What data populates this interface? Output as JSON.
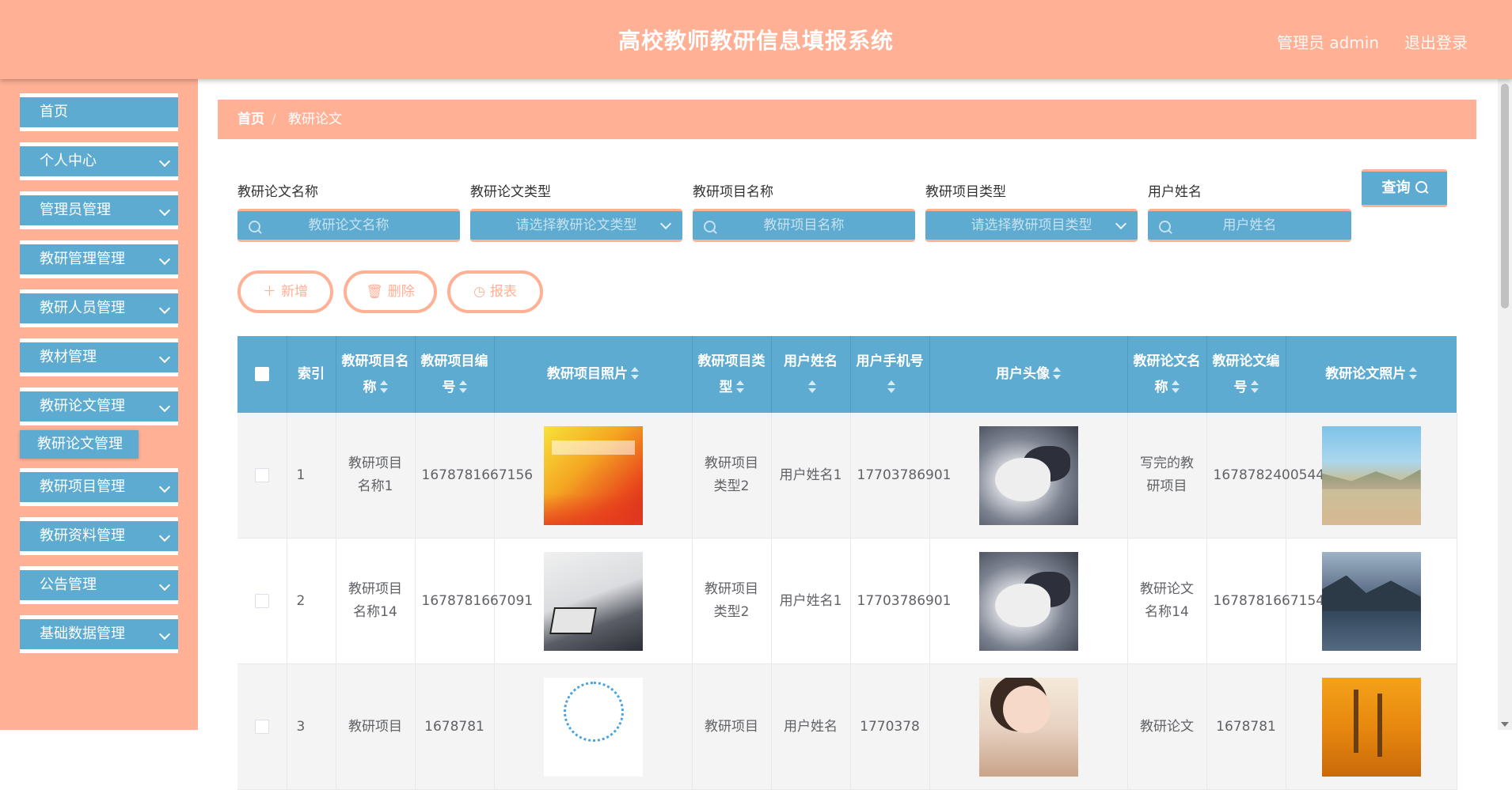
{
  "header": {
    "title": "高校教师教研信息填报系统",
    "user": "管理员 admin",
    "logout": "退出登录"
  },
  "sidebar": {
    "items": [
      {
        "label": "首页"
      },
      {
        "label": "个人中心"
      },
      {
        "label": "管理员管理"
      },
      {
        "label": "教研管理管理"
      },
      {
        "label": "教研人员管理"
      },
      {
        "label": "教材管理"
      },
      {
        "label": "教研论文管理"
      },
      {
        "label": "教研项目管理"
      },
      {
        "label": "教研资料管理"
      },
      {
        "label": "公告管理"
      },
      {
        "label": "基础数据管理"
      }
    ],
    "active_sub": "教研论文管理"
  },
  "breadcrumb": {
    "home": "首页",
    "separator": "/",
    "current": "教研论文"
  },
  "search": {
    "fields": [
      {
        "label": "教研论文名称",
        "placeholder": "教研论文名称"
      },
      {
        "label": "教研论文类型",
        "placeholder": "请选择教研论文类型"
      },
      {
        "label": "教研项目名称",
        "placeholder": "教研项目名称"
      },
      {
        "label": "教研项目类型",
        "placeholder": "请选择教研项目类型"
      },
      {
        "label": "用户姓名",
        "placeholder": "用户姓名"
      }
    ],
    "query_label": "查询"
  },
  "actions": {
    "add": "新增",
    "delete": "删除",
    "report": "报表"
  },
  "table": {
    "headers": [
      "索引",
      "教研项目名称",
      "教研项目编号",
      "教研项目照片",
      "教研项目类型",
      "用户姓名",
      "用户手机号",
      "用户头像",
      "教研论文名称",
      "教研论文编号",
      "教研论文照片"
    ],
    "rows": [
      {
        "index": "1",
        "project_name": "教研项目名称1",
        "project_no": "1678781667156",
        "project_photo": "poster-image",
        "project_type": "教研项目类型2",
        "user_name": "用户姓名1",
        "phone": "17703786901",
        "avatar": "husky-image",
        "paper_name": "写完的教研项目",
        "paper_no": "1678782400544",
        "paper_photo": "desert-image"
      },
      {
        "index": "2",
        "project_name": "教研项目名称14",
        "project_no": "1678781667091",
        "project_photo": "business-image",
        "project_type": "教研项目类型2",
        "user_name": "用户姓名1",
        "phone": "17703786901",
        "avatar": "husky-image",
        "paper_name": "教研论文名称14",
        "paper_no": "1678781667154",
        "paper_photo": "lake-image"
      },
      {
        "index": "3",
        "project_name": "教研项目",
        "project_no": "1678781",
        "project_photo": "network-image",
        "project_type": "教研项目",
        "user_name": "用户姓名",
        "phone": "1770378",
        "avatar": "girl-image",
        "paper_name": "教研论文",
        "paper_no": "1678781",
        "paper_photo": "autumn-image"
      }
    ]
  },
  "colors": {
    "accent": "#ffb095",
    "primary": "#5dabd1"
  }
}
